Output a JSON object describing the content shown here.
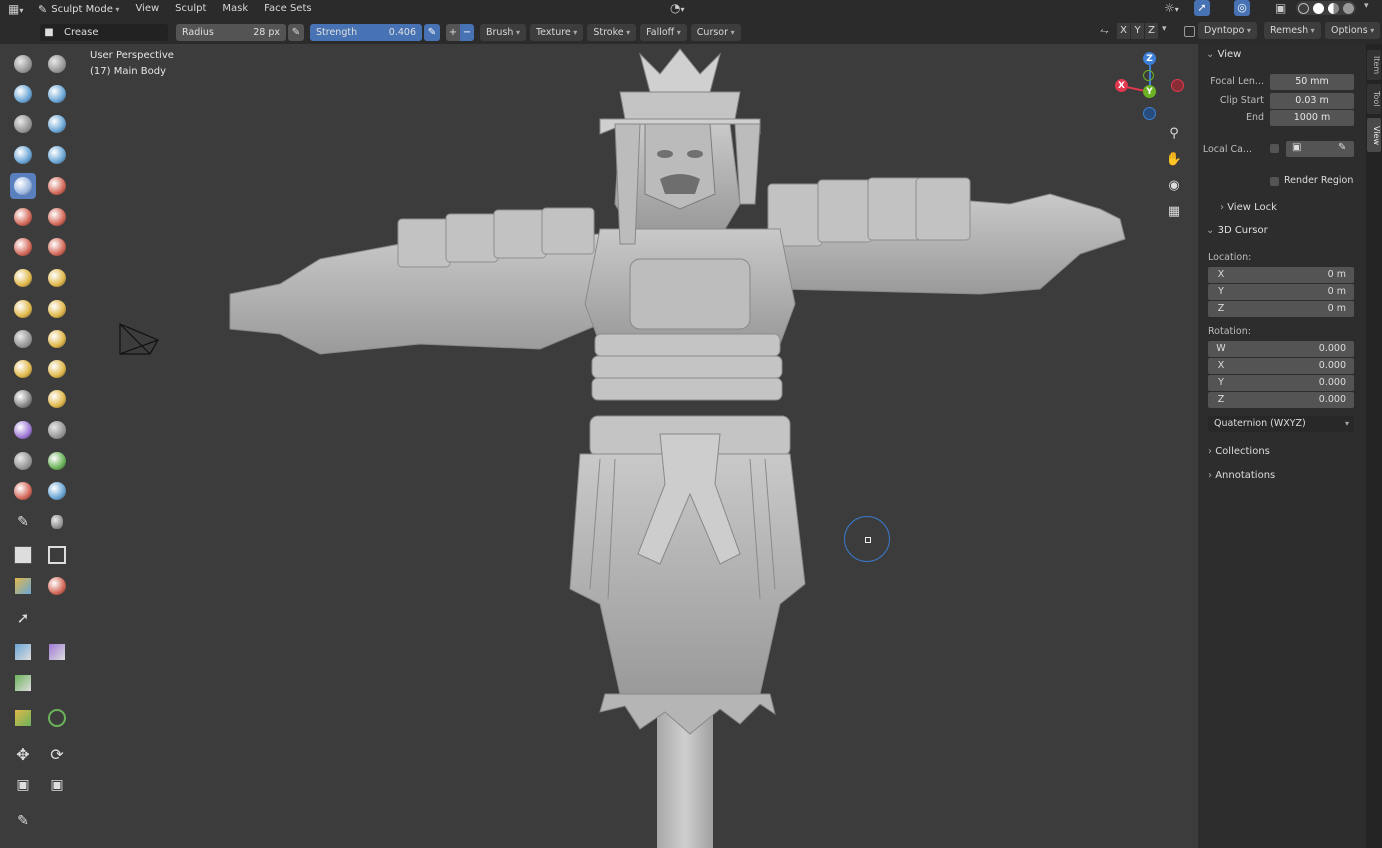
{
  "header": {
    "mode": "Sculpt Mode",
    "menus": [
      "View",
      "Sculpt",
      "Mask",
      "Face Sets"
    ],
    "brush_name": "Crease",
    "radius_label": "Radius",
    "radius_value": "28 px",
    "strength_label": "Strength",
    "strength_value": "0.406",
    "dropdowns": [
      "Brush",
      "Texture",
      "Stroke",
      "Falloff",
      "Cursor"
    ],
    "axis": [
      "X",
      "Y",
      "Z"
    ],
    "dyntopo": "Dyntopo",
    "remesh": "Remesh",
    "options": "Options"
  },
  "viewport": {
    "perspective": "User Perspective",
    "object": "(17) Main Body",
    "gizmo": {
      "x": "X",
      "y": "Y",
      "z": "Z",
      "x_color": "#e0384f",
      "y_color": "#6bb323",
      "z_color": "#3c7fd6"
    }
  },
  "tools": [
    "draw-icon",
    "draw-sharp-icon",
    "clay-icon",
    "clay-strips-icon",
    "clay-thumb-icon",
    "layer-icon",
    "inflate-icon",
    "blob-icon",
    "crease-icon",
    "smooth-icon",
    "flatten-icon",
    "fill-icon",
    "scrape-icon",
    "multiplane-scrape-icon",
    "pinch-icon",
    "grab-icon",
    "elastic-deform-icon",
    "snake-hook-icon",
    "thumb-icon",
    "pose-icon",
    "nudge-icon",
    "rotate-icon",
    "slide-relax-icon",
    "boundary-icon",
    "cloth-icon",
    "simplify-icon",
    "mask-icon",
    "draw-face-sets-icon",
    "box-mask-icon",
    "box-hide-icon",
    "box-face-set-icon",
    "box-trim-icon",
    "line-project-icon",
    "mesh-filter-icon",
    "cloth-filter-icon",
    "color-filter-icon",
    "edit-face-set-icon",
    "mask-by-color-icon",
    "move-icon",
    "rotate-transform-icon",
    "scale-icon",
    "transform-icon",
    "annotate-icon"
  ],
  "sidebar": {
    "tabs": [
      "Item",
      "Tool",
      "View"
    ],
    "view": {
      "title": "View",
      "focal_length_label": "Focal Len...",
      "focal_length": "50 mm",
      "clip_start_label": "Clip Start",
      "clip_start": "0.03 m",
      "clip_end_label": "End",
      "clip_end": "1000 m",
      "local_camera_label": "Local Ca...",
      "render_region_label": "Render Region",
      "view_lock_label": "View Lock"
    },
    "cursor": {
      "title": "3D Cursor",
      "location_label": "Location:",
      "loc": [
        {
          "axis": "X",
          "value": "0 m"
        },
        {
          "axis": "Y",
          "value": "0 m"
        },
        {
          "axis": "Z",
          "value": "0 m"
        }
      ],
      "rotation_label": "Rotation:",
      "rot": [
        {
          "axis": "W",
          "value": "0.000"
        },
        {
          "axis": "X",
          "value": "0.000"
        },
        {
          "axis": "Y",
          "value": "0.000"
        },
        {
          "axis": "Z",
          "value": "0.000"
        }
      ],
      "rotation_mode": "Quaternion (WXYZ)"
    },
    "collections_label": "Collections",
    "annotations_label": "Annotations"
  }
}
